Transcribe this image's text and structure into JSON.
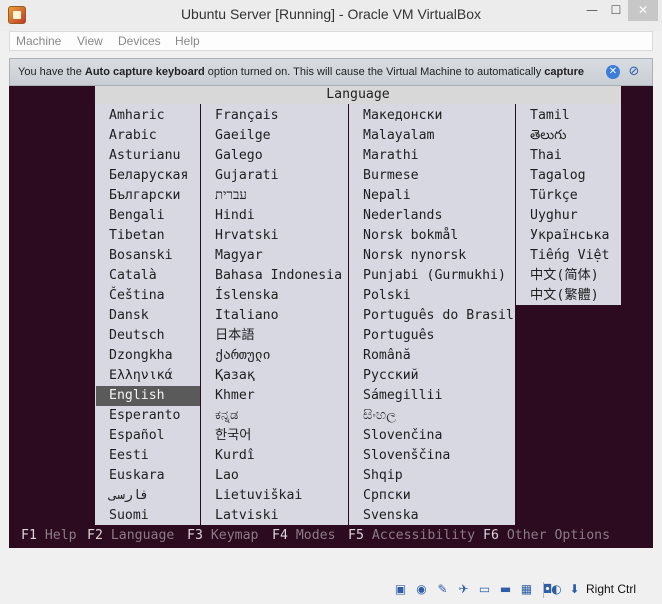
{
  "window": {
    "title": "Ubuntu Server [Running] - Oracle VM VirtualBox",
    "min_glyph": "—",
    "max_glyph": "☐",
    "close_glyph": "✕"
  },
  "menu": {
    "items": [
      "Machine",
      "View",
      "Devices",
      "Help"
    ]
  },
  "notice": {
    "part1": "You have the ",
    "bold1": "Auto capture keyboard",
    "part2": " option turned on. This will cause the Virtual Machine to automatically ",
    "bold2": "capture",
    "close_glyph": "✕",
    "mute_glyph": "⊘"
  },
  "installer": {
    "header": "Language",
    "columns": [
      [
        "Amharic",
        "Arabic",
        "Asturianu",
        "Беларуская",
        "Български",
        "Bengali",
        "Tibetan",
        "Bosanski",
        "Català",
        "Čeština",
        "Dansk",
        "Deutsch",
        "Dzongkha",
        "Ελληνικά",
        "English",
        "Esperanto",
        "Español",
        "Eesti",
        "Euskara",
        "فارسی",
        "Suomi"
      ],
      [
        "Français",
        "Gaeilge",
        "Galego",
        "Gujarati",
        "עברית",
        "Hindi",
        "Hrvatski",
        "Magyar",
        "Bahasa Indonesia",
        "Íslenska",
        "Italiano",
        "日本語",
        "ქართული",
        "Қазақ",
        "Khmer",
        "ಕನ್ನಡ",
        "한국어",
        "Kurdî",
        "Lao",
        "Lietuviškai",
        "Latviski"
      ],
      [
        "Македонски",
        "Malayalam",
        "Marathi",
        "Burmese",
        "Nepali",
        "Nederlands",
        "Norsk bokmål",
        "Norsk nynorsk",
        "Punjabi (Gurmukhi)",
        "Polski",
        "Português do Brasil",
        "Português",
        "Română",
        "Русский",
        "Sámegillii",
        "සිංහල",
        "Slovenčina",
        "Slovenščina",
        "Shqip",
        "Српски",
        "Svenska"
      ],
      [
        "Tamil",
        "తెలుగు",
        "Thai",
        "Tagalog",
        "Türkçe",
        "Uyghur",
        "Українська",
        "Tiếng Việt",
        "中文(简体)",
        "中文(繁體)"
      ]
    ],
    "selected": "English",
    "function_keys": [
      {
        "key": "F1",
        "label": "Help"
      },
      {
        "key": "F2",
        "label": "Language"
      },
      {
        "key": "F3",
        "label": "Keymap"
      },
      {
        "key": "F4",
        "label": "Modes"
      },
      {
        "key": "F5",
        "label": "Accessibility"
      },
      {
        "key": "F6",
        "label": "Other Options"
      }
    ]
  },
  "statusbar": {
    "icons": [
      "hard-disk-icon",
      "optical-drive-icon",
      "usb-icon",
      "audio-icon",
      "shared-folders-icon",
      "display-icon",
      "network-icon",
      "recording-icon",
      "mouse-integration-icon",
      "keyboard-capture-icon"
    ],
    "icon_glyphs": [
      "▣",
      "◉",
      "✎",
      "✈",
      "▭",
      "▬",
      "▦",
      "◘",
      "◐",
      "⬇"
    ],
    "host_key": "Right Ctrl"
  }
}
